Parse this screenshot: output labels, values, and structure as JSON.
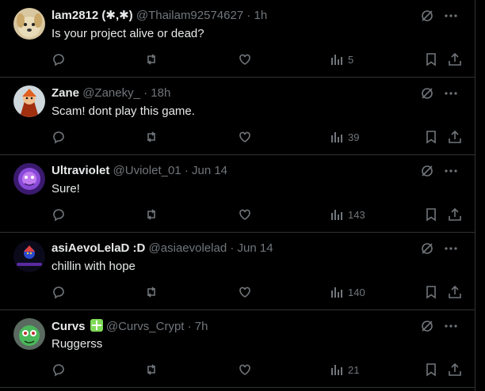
{
  "tweets": [
    {
      "name": "lam2812 (✱,✱)",
      "handle": "@Thailam92574627",
      "time": "1h",
      "text": "Is your project alive or dead?",
      "views": "5",
      "avatar_icon": "dog-avatar",
      "verified": false
    },
    {
      "name": "Zane",
      "handle": "@Zaneky_",
      "time": "18h",
      "text": "Scam! dont play this game.",
      "views": "39",
      "avatar_icon": "character-avatar",
      "verified": false
    },
    {
      "name": "Ultraviolet",
      "handle": "@Uviolet_01",
      "time": "Jun 14",
      "text": "Sure!",
      "views": "143",
      "avatar_icon": "purple-creature-avatar",
      "verified": false
    },
    {
      "name": "asiAevoLelaD :D",
      "handle": "@asiaevolelad",
      "time": "Jun 14",
      "text": "chillin with hope",
      "views": "140",
      "avatar_icon": "dark-character-avatar",
      "verified": false
    },
    {
      "name": "Curvs",
      "handle": "@Curvs_Crypt",
      "time": "7h",
      "text": "Ruggerss",
      "views": "21",
      "avatar_icon": "green-creature-avatar",
      "verified": true
    }
  ],
  "separator": "·",
  "colors": {
    "background": "#000000",
    "text": "#e7e9ea",
    "muted": "#71767b",
    "divider": "#2f3336",
    "badge": "#7ed957"
  }
}
